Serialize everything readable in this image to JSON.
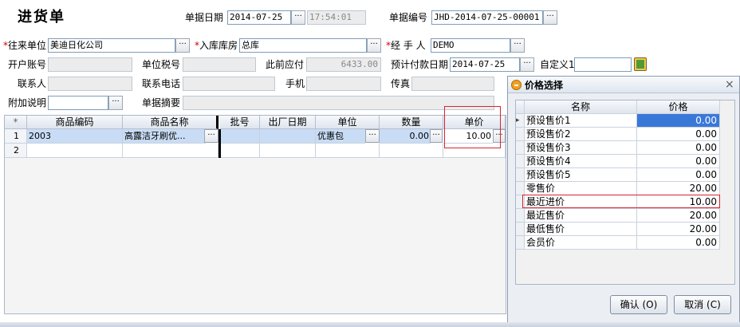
{
  "title": "进货单",
  "header": {
    "date_label": "单据日期",
    "date_value": "2014-07-25",
    "time_value": "17:54:01",
    "docno_label": "单据编号",
    "docno_value": "JHD-2014-07-25-00001"
  },
  "form": {
    "supplier_label": "往来单位",
    "supplier_value": "美迪日化公司",
    "warehouse_label": "入库库房",
    "warehouse_value": "总库",
    "handler_label": "经 手 人",
    "handler_value": "DEMO",
    "account_label": "开户账号",
    "taxno_label": "单位税号",
    "payable_label": "此前应付",
    "payable_value": "6433.00",
    "paydate_label": "预计付款日期",
    "paydate_value": "2014-07-25",
    "custom1_label": "自定义1",
    "contact_label": "联系人",
    "phone_label": "联系电话",
    "mobile_label": "手机",
    "fax_label": "传真",
    "note_label": "附加说明",
    "summary_label": "单据摘要",
    "required_mark": "*"
  },
  "grid": {
    "columns": [
      "*",
      "商品编码",
      "商品名称",
      "批号",
      "出厂日期",
      "单位",
      "数量",
      "单价"
    ],
    "rows": [
      {
        "no": "1",
        "code": "2003",
        "name": "高露洁牙刷优...",
        "batch": "",
        "date": "",
        "unit": "优惠包",
        "qty": "0.00",
        "price": "10.00"
      },
      {
        "no": "2",
        "code": "",
        "name": "",
        "batch": "",
        "date": "",
        "unit": "",
        "qty": "",
        "price": ""
      }
    ]
  },
  "dialog": {
    "title": "价格选择",
    "col_name": "名称",
    "col_price": "价格",
    "rows": [
      {
        "name": "预设售价1",
        "price": "0.00"
      },
      {
        "name": "预设售价2",
        "price": "0.00"
      },
      {
        "name": "预设售价3",
        "price": "0.00"
      },
      {
        "name": "预设售价4",
        "price": "0.00"
      },
      {
        "name": "预设售价5",
        "price": "0.00"
      },
      {
        "name": "零售价",
        "price": "20.00"
      },
      {
        "name": "最近进价",
        "price": "10.00"
      },
      {
        "name": "最近售价",
        "price": "20.00"
      },
      {
        "name": "最低售价",
        "price": "20.00"
      },
      {
        "name": "会员价",
        "price": "0.00"
      }
    ],
    "ok_label": "确认 (O)",
    "cancel_label": "取消 (C)",
    "close_icon": "×"
  },
  "icons": {
    "ellipsis": "···",
    "row_pointer": "▸",
    "calculator_icon": "calculator-icon",
    "dialog_icon": "app-icon"
  },
  "colors": {
    "accent_selection": "#3a78d8",
    "highlight_box": "#d9232f",
    "required": "#d00000"
  }
}
